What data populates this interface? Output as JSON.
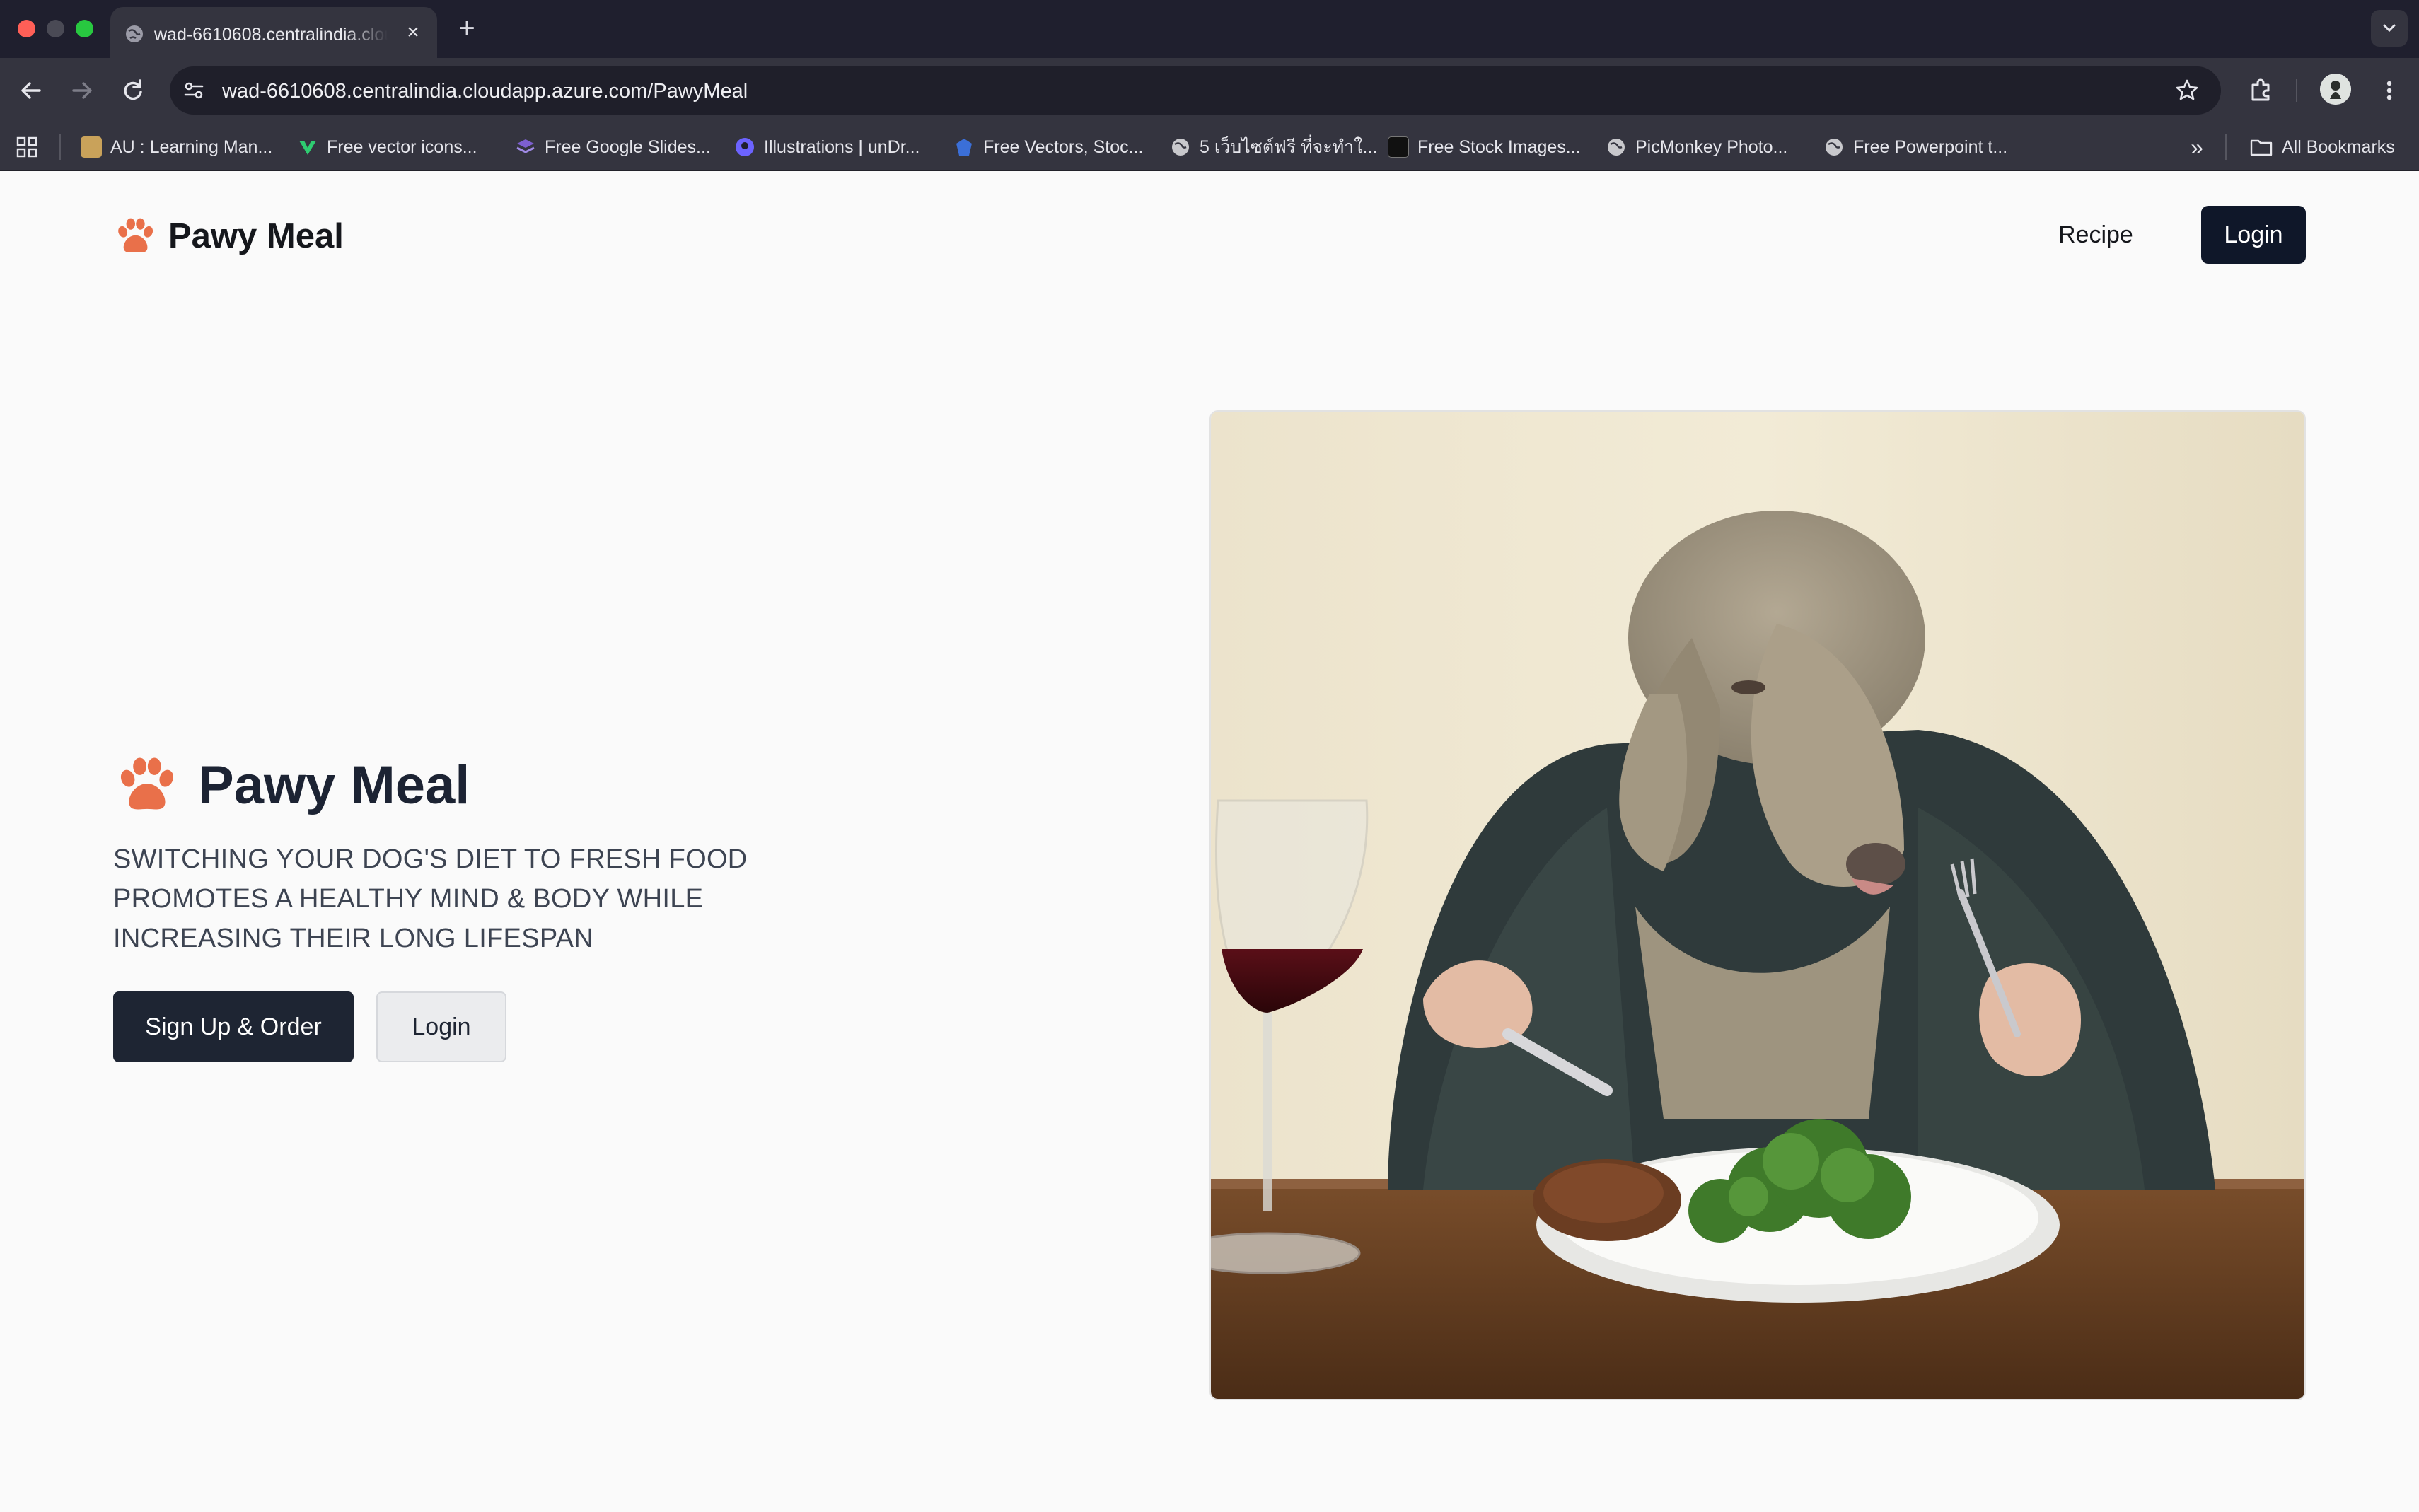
{
  "browser": {
    "tab_title": "wad-6610608.centralindia.cloudapp.azure.com",
    "tab_close": "×",
    "new_tab": "+",
    "url": "wad-6610608.centralindia.cloudapp.azure.com/PawyMeal",
    "bookmarks": [
      {
        "label": "AU : Learning Man...",
        "color": "#c9a25a"
      },
      {
        "label": "Free vector icons...",
        "color": "#2ecc71"
      },
      {
        "label": "Free Google Slides...",
        "color": "#7d5fd0"
      },
      {
        "label": "Illustrations | unDr...",
        "color": "#6c63ff"
      },
      {
        "label": "Free Vectors, Stoc...",
        "color": "#3b6fd8"
      },
      {
        "label": "5 เว็บไซต์ฟรี ที่จะทำใ...",
        "color": "#c8c8cc"
      },
      {
        "label": "Free Stock Images...",
        "color": "#111111"
      },
      {
        "label": "PicMonkey Photo...",
        "color": "#c8c8cc"
      },
      {
        "label": "Free Powerpoint t...",
        "color": "#c8c8cc"
      }
    ],
    "more": "»",
    "all_bookmarks": "All Bookmarks"
  },
  "navbar": {
    "brand": "Pawy Meal",
    "recipe_link": "Recipe",
    "login_button": "Login"
  },
  "hero": {
    "title": "Pawy Meal",
    "description": "SWITCHING YOUR DOG'S DIET TO FRESH FOOD PROMOTES A HEALTHY MIND & BODY WHILE INCREASING THEIR LONG LIFESPAN",
    "primary_button": "Sign Up & Order",
    "secondary_button": "Login"
  },
  "colors": {
    "accent": "#e9704a",
    "dark_button": "#1e2533"
  }
}
